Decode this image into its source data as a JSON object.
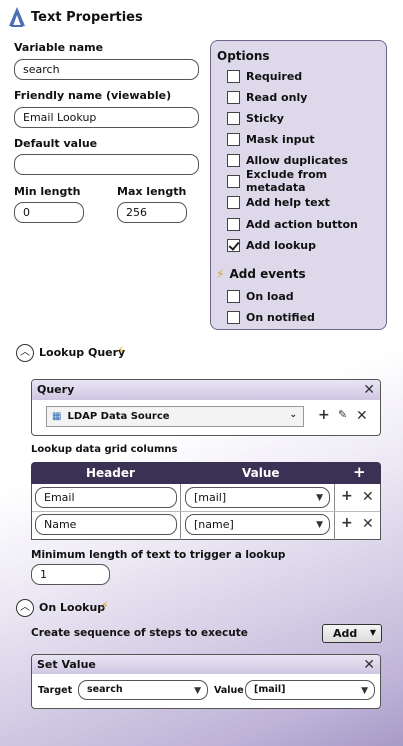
{
  "app": {
    "title": "Text Properties",
    "logo_icon": "a-logo-icon"
  },
  "fields": {
    "variable_name": {
      "label": "Variable name",
      "value": "search"
    },
    "friendly_name": {
      "label": "Friendly name (viewable)",
      "value": "Email Lookup"
    },
    "default_value": {
      "label": "Default value",
      "value": ""
    },
    "min_length": {
      "label": "Min length",
      "value": "0"
    },
    "max_length": {
      "label": "Max length",
      "value": "256"
    }
  },
  "options": {
    "title": "Options",
    "items": [
      {
        "label": "Required",
        "checked": false
      },
      {
        "label": "Read only",
        "checked": false
      },
      {
        "label": "Sticky",
        "checked": false
      },
      {
        "label": "Mask input",
        "checked": false
      },
      {
        "label": "Allow duplicates",
        "checked": false
      },
      {
        "label": "Exclude from metadata",
        "checked": false
      },
      {
        "label": "Add help text",
        "checked": false
      },
      {
        "label": "Add action button",
        "checked": false
      },
      {
        "label": "Add lookup",
        "checked": true
      }
    ],
    "events_title": "Add events",
    "events": [
      {
        "label": "On load",
        "checked": false
      },
      {
        "label": "On notified",
        "checked": false
      }
    ]
  },
  "lookup_query": {
    "section_label": "Lookup Query",
    "query_panel_title": "Query",
    "data_source": "LDAP Data Source",
    "grid_title": "Lookup data grid columns",
    "grid_headers": [
      "Header",
      "Value"
    ],
    "rows": [
      {
        "header": "Email",
        "value": "[mail]"
      },
      {
        "header": "Name",
        "value": "[name]"
      }
    ],
    "min_trigger_label": "Minimum length of text to trigger a lookup",
    "min_trigger_value": "1"
  },
  "on_lookup": {
    "section_label": "On Lookup",
    "sequence_label": "Create sequence of steps to execute",
    "add_button": "Add",
    "set_value_title": "Set Value",
    "target_label": "Target",
    "target_value": "search",
    "value_label": "Value",
    "value_value": "[mail]"
  },
  "colors": {
    "accent_dark": "#3a3154",
    "options_bg": "#ddd8ea",
    "bolt": "#d9a628"
  }
}
